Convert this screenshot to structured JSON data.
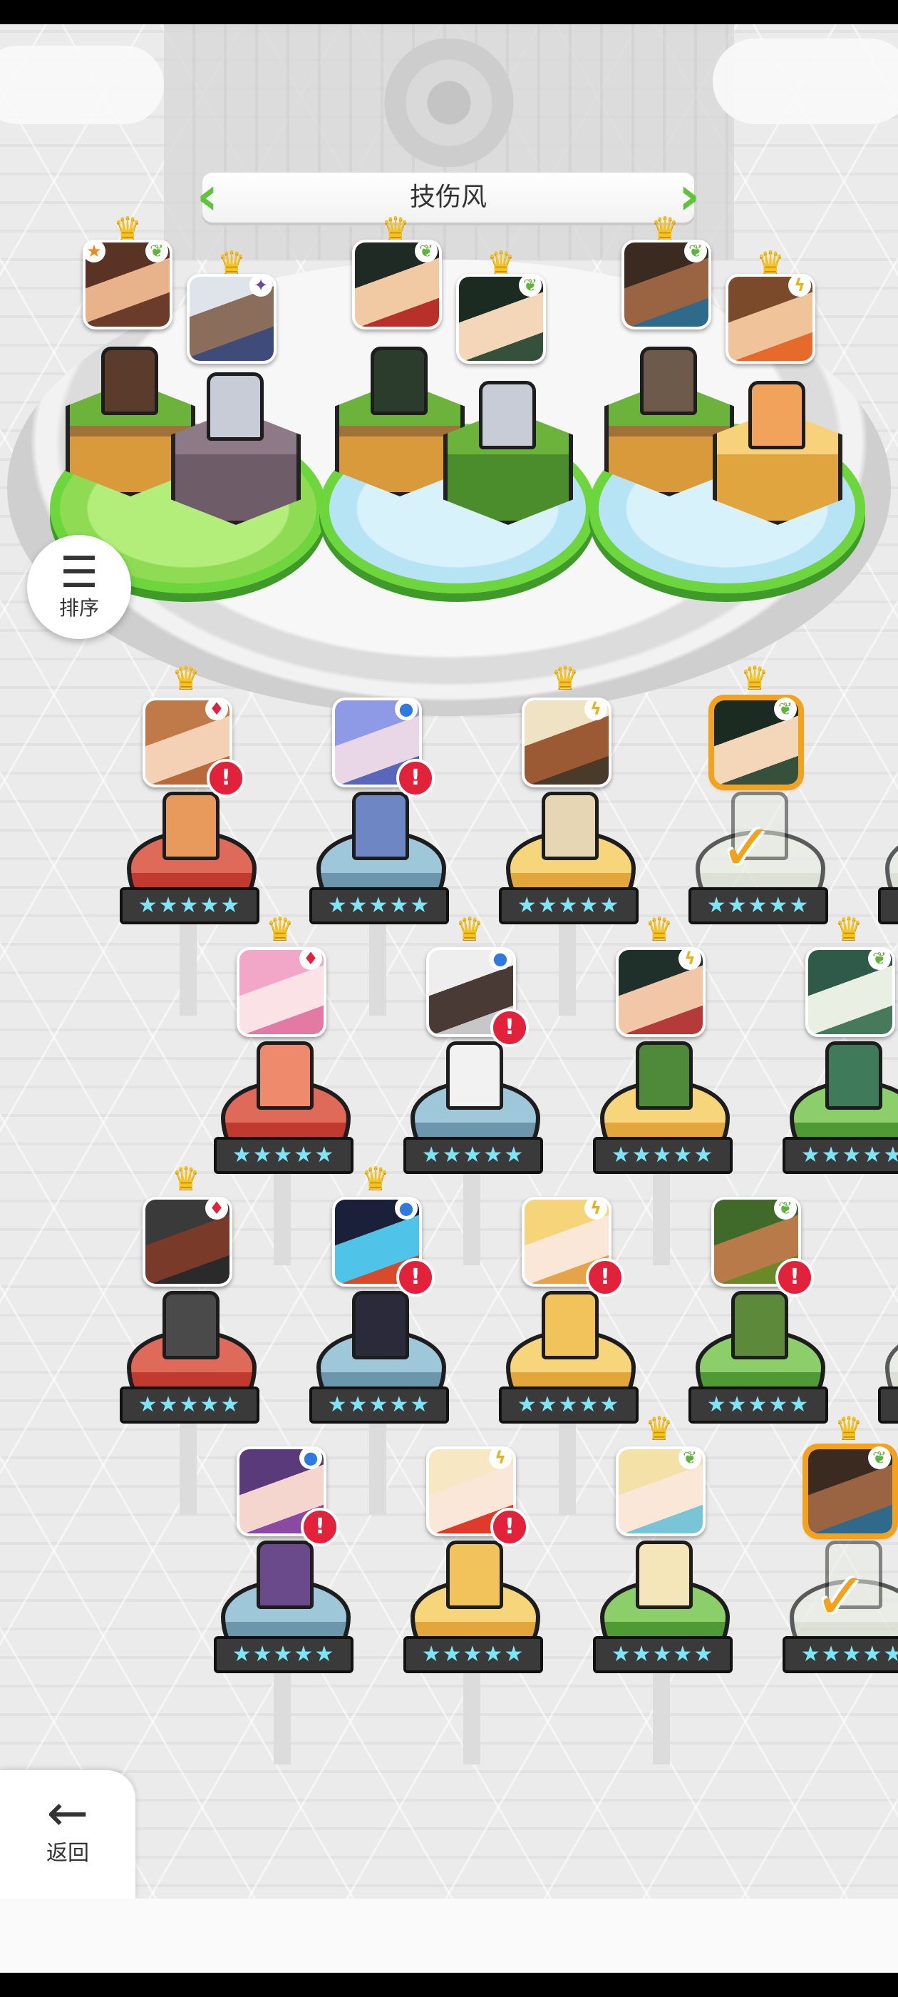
{
  "team": {
    "title": "技伤风"
  },
  "buttons": {
    "sort_label": "排序",
    "sort_icon": "sort-icon",
    "back_label": "返回",
    "back_icon": "arrow-left-icon"
  },
  "stars_text": "★★★★★",
  "alert_mark": "!",
  "check_mark": "✓",
  "crown_mark": "♛",
  "element_icons": {
    "leaf": "leaf-icon",
    "lightning": "lightning-icon",
    "water": "water-icon",
    "fire": "fire-icon",
    "dark": "dark-icon",
    "star": "star-icon"
  },
  "colors": {
    "accent_green": "#6dd63d",
    "selected_orange": "#f4a21c",
    "alert_red": "#e2213b",
    "star_cyan": "#7ce5f7"
  }
}
